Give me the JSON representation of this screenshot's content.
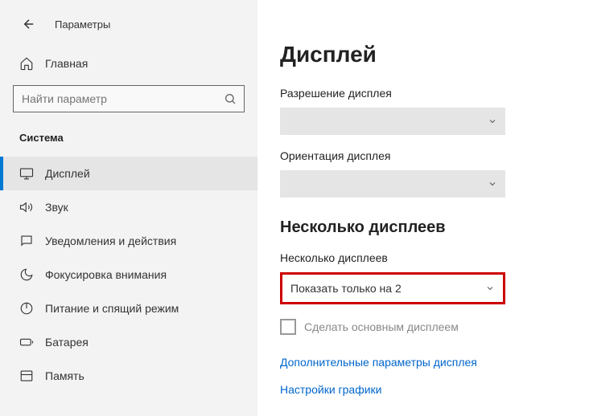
{
  "header": {
    "app_title": "Параметры",
    "home_label": "Главная"
  },
  "search": {
    "placeholder": "Найти параметр"
  },
  "sidebar": {
    "section_label": "Система",
    "items": [
      {
        "label": "Дисплей"
      },
      {
        "label": "Звук"
      },
      {
        "label": "Уведомления и действия"
      },
      {
        "label": "Фокусировка внимания"
      },
      {
        "label": "Питание и спящий режим"
      },
      {
        "label": "Батарея"
      },
      {
        "label": "Память"
      }
    ]
  },
  "main": {
    "page_title": "Дисплей",
    "resolution_label": "Разрешение дисплея",
    "orientation_label": "Ориентация дисплея",
    "multi_heading": "Несколько дисплеев",
    "multi_label": "Несколько дисплеев",
    "multi_value": "Показать только на 2",
    "make_primary_label": "Сделать основным дисплеем",
    "advanced_link": "Дополнительные параметры дисплея",
    "graphics_link": "Настройки графики"
  }
}
